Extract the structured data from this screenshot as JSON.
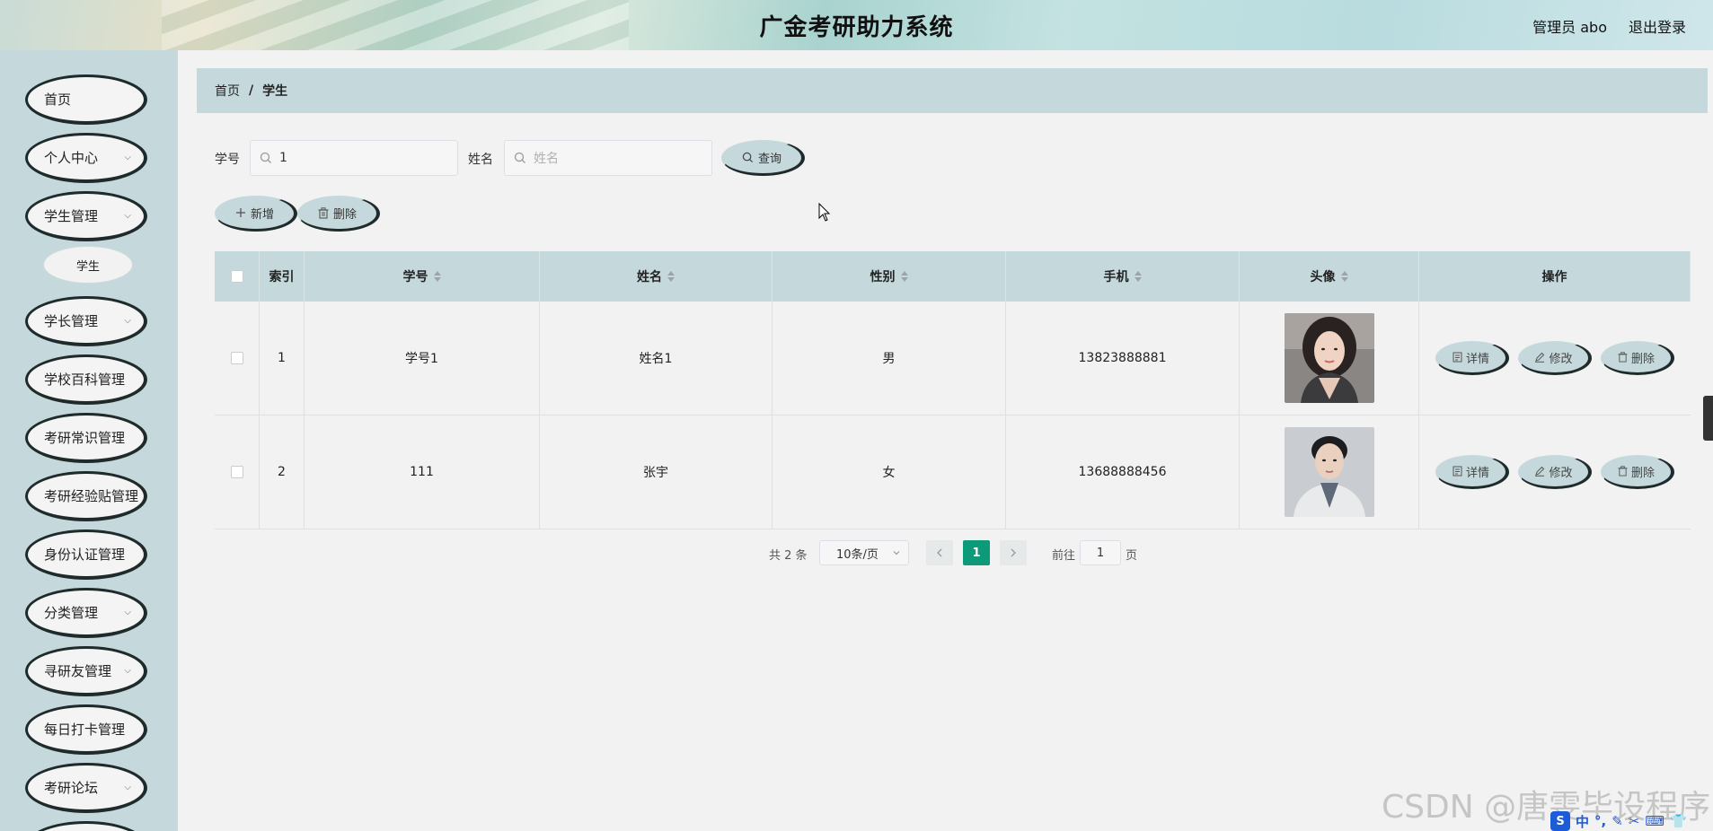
{
  "header": {
    "title": "广金考研助力系统",
    "user": "管理员 abo",
    "logout": "退出登录"
  },
  "sidebar": {
    "items": [
      {
        "label": "首页",
        "has_children": false
      },
      {
        "label": "个人中心",
        "has_children": true
      },
      {
        "label": "学生管理",
        "has_children": true
      },
      {
        "label": "学长管理",
        "has_children": true
      },
      {
        "label": "学校百科管理",
        "has_children": false
      },
      {
        "label": "考研常识管理",
        "has_children": false
      },
      {
        "label": "考研经验贴管理",
        "has_children": false
      },
      {
        "label": "身份认证管理",
        "has_children": false
      },
      {
        "label": "分类管理",
        "has_children": true
      },
      {
        "label": "寻研友管理",
        "has_children": true
      },
      {
        "label": "每日打卡管理",
        "has_children": false
      },
      {
        "label": "考研论坛",
        "has_children": true
      }
    ],
    "sub_items": [
      {
        "label": "学生"
      }
    ]
  },
  "breadcrumb": {
    "home": "首页",
    "separator": "/",
    "current": "学生"
  },
  "search": {
    "sno_label": "学号",
    "sno_value": "1",
    "name_label": "姓名",
    "name_placeholder": "姓名",
    "query_button": "查询"
  },
  "actions": {
    "add": "新增",
    "delete": "删除"
  },
  "table": {
    "columns": [
      "索引",
      "学号",
      "姓名",
      "性别",
      "手机",
      "头像",
      "操作"
    ],
    "rows": [
      {
        "index": "1",
        "sno": "学号1",
        "name": "姓名1",
        "sex": "男",
        "phone": "13823888881",
        "avatar": "female-portrait"
      },
      {
        "index": "2",
        "sno": "111",
        "name": "张宇",
        "sex": "女",
        "phone": "13688888456",
        "avatar": "male-portrait"
      }
    ],
    "row_actions": {
      "detail": "详情",
      "edit": "修改",
      "delete": "删除"
    }
  },
  "pagination": {
    "total": "共 2 条",
    "page_size": "10条/页",
    "current_page": "1",
    "goto_label": "前往",
    "goto_value": "1",
    "page_suffix": "页"
  },
  "overlay": {
    "watermark": "CSDN @唐雯毕设程序",
    "ime_label": "中"
  },
  "colors": {
    "accent": "#c5d9dd",
    "primary": "#0d9a78",
    "border_dark": "#1f2b2b"
  }
}
